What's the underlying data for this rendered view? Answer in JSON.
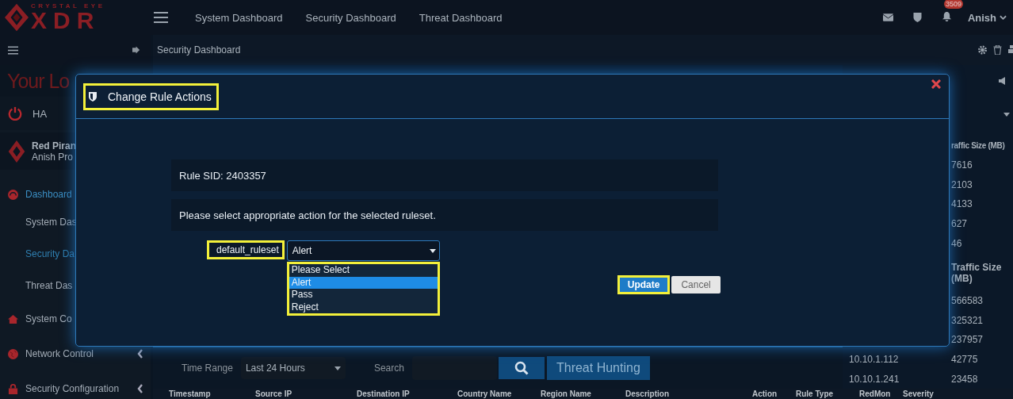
{
  "logo": {
    "tagline": "CRYSTAL EYE",
    "name": "XDR"
  },
  "top_nav": {
    "links": [
      {
        "label": "System Dashboard"
      },
      {
        "label": "Security Dashboard"
      },
      {
        "label": "Threat Dashboard"
      }
    ],
    "notification_count": "3509",
    "user": "Anish"
  },
  "sidebar": {
    "banner": "Your Lo",
    "ha_label": "HA",
    "profile": {
      "name": "Red Piran",
      "subtitle": "Anish Pro"
    },
    "items": [
      {
        "label": "Dashboard",
        "selected": true,
        "children": [
          {
            "label": "System Das",
            "selected": false
          },
          {
            "label": "Security Da",
            "selected": true
          },
          {
            "label": "Threat Das",
            "selected": false
          }
        ]
      },
      {
        "label": "System Co",
        "selected": false
      },
      {
        "label": "Network Control",
        "selected": false,
        "expanded": false
      },
      {
        "label": "Security Configuration",
        "selected": false,
        "expanded": false
      }
    ]
  },
  "page_header": {
    "title": "Security Dashboard"
  },
  "traffic_summary": {
    "header": "raffic Size (MB)",
    "values": [
      "7616",
      "2103",
      "4133",
      "627",
      "46"
    ]
  },
  "device_traffic": {
    "header": "Traffic Size (MB)",
    "rows": [
      {
        "size": "566583"
      },
      {
        "size": "325321"
      },
      {
        "size": "237957"
      },
      {
        "device": "10.10.1.112",
        "size": "42775"
      },
      {
        "device": "10.10.1.241",
        "size": "23458"
      }
    ]
  },
  "filter_bar": {
    "time_range_label": "Time Range",
    "time_range": "Last 24 Hours",
    "search_label": "Search",
    "threat_hunting": "Threat Hunting"
  },
  "table": {
    "columns": [
      "Timestamp",
      "Source IP",
      "Destination IP",
      "Country Name",
      "Region Name",
      "Description",
      "Action",
      "Rule Type",
      "RedMon",
      "Severity"
    ]
  },
  "modal": {
    "title": "Change Rule Actions",
    "rule_sid": "Rule SID: 2403357",
    "instruction": "Please select appropriate action for the selected ruleset.",
    "ruleset_label": "default_ruleset",
    "select_value": "Alert",
    "options": [
      {
        "label": "Please Select",
        "selected": false
      },
      {
        "label": "Alert",
        "selected": true
      },
      {
        "label": "Pass",
        "selected": false
      },
      {
        "label": "Reject",
        "selected": false
      }
    ],
    "buttons": [
      {
        "label": "Update",
        "kind": "primary"
      },
      {
        "label": "Cancel",
        "kind": "secondary"
      }
    ]
  }
}
